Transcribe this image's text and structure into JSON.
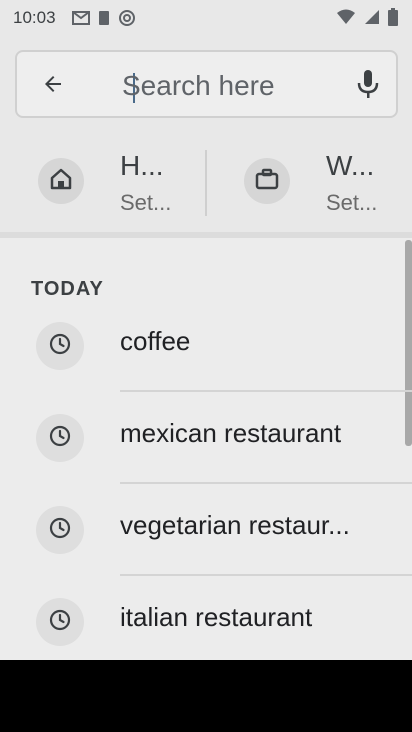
{
  "status_bar": {
    "time": "10:03",
    "left_icons": [
      "gmail-icon",
      "square-icon",
      "at-icon"
    ],
    "right_icons": [
      "wifi-icon",
      "signal-icon",
      "battery-icon"
    ]
  },
  "search": {
    "placeholder": "Search here",
    "back_icon": "arrow-back-icon",
    "mic_icon": "mic-icon"
  },
  "shortcuts": [
    {
      "title": "H...",
      "subtitle": "Set...",
      "icon": "home-icon"
    },
    {
      "title": "W...",
      "subtitle": "Set...",
      "icon": "briefcase-icon"
    }
  ],
  "history": {
    "section_label": "TODAY",
    "items": [
      {
        "label": "coffee",
        "icon": "clock-icon"
      },
      {
        "label": "mexican restaurant",
        "icon": "clock-icon"
      },
      {
        "label": "vegetarian restaur...",
        "icon": "clock-icon"
      },
      {
        "label": "italian restaurant",
        "icon": "clock-icon"
      }
    ]
  },
  "colors": {
    "background": "#ececec",
    "nav_bar": "#000000",
    "text": "#202124"
  }
}
